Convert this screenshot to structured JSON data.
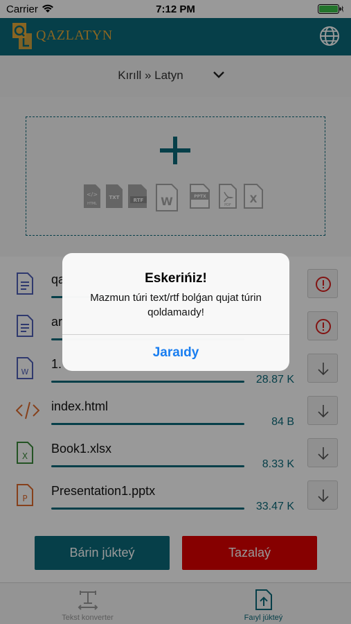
{
  "status_bar": {
    "carrier": "Carrier",
    "time": "7:12 PM"
  },
  "app": {
    "logo_letters": "QL",
    "title": "QAZLATYN",
    "accent": "#0a6a7a",
    "logo_color": "#e4a93a"
  },
  "direction_selector": {
    "label": "Kırıll » Latyn"
  },
  "dropzone": {
    "filetypes": [
      "html",
      "txt",
      "rtf",
      "word",
      "pptx",
      "pdf",
      "xlsx"
    ],
    "labels": {
      "html": "HTML",
      "txt": "TXT",
      "rtf": "RTF",
      "word": "W",
      "pptx": "PPTX",
      "pdf": "PDF",
      "xlsx": "X"
    }
  },
  "files": [
    {
      "name": "qa",
      "icon": "text-file-icon",
      "status": "error"
    },
    {
      "name": "ar",
      "icon": "text-file-icon",
      "status": "error"
    },
    {
      "name": "1.",
      "icon": "word-file-icon",
      "size": "28.87 K",
      "status": "download"
    },
    {
      "name": "index.html",
      "icon": "code-file-icon",
      "size": "84 B",
      "status": "download"
    },
    {
      "name": "Book1.xlsx",
      "icon": "excel-file-icon",
      "size": "8.33 K",
      "status": "download"
    },
    {
      "name": "Presentation1.pptx",
      "icon": "powerpoint-file-icon",
      "size": "33.47 K",
      "status": "download"
    }
  ],
  "actions": {
    "upload_all": "Bárin júkteý",
    "clear": "Tazalaý"
  },
  "tabs": [
    {
      "label": "Tekst konverter",
      "active": false
    },
    {
      "label": "Faıyl júkteý",
      "active": true
    }
  ],
  "alert": {
    "title": "Eskerińiz!",
    "message": "Mazmun túri text/rtf bolǵan qujat túrin qoldamaıdy!",
    "button": "Jaraıdy"
  }
}
